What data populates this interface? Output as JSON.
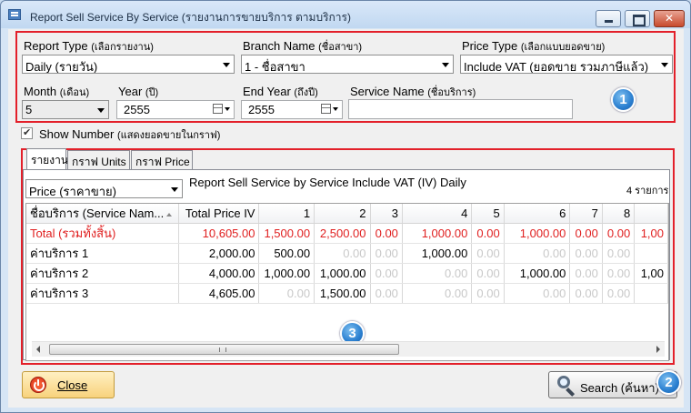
{
  "window": {
    "title": "Report Sell Service By Service (รายงานการขายบริการ ตามบริการ)"
  },
  "filters": {
    "report_type": {
      "label": "Report Type",
      "label_th": "(เลือกรายงาน)",
      "value": "Daily (รายวัน)"
    },
    "branch_name": {
      "label": "Branch Name",
      "label_th": "(ชื่อสาขา)",
      "value": "1 - ชื่อสาขา"
    },
    "price_type": {
      "label": "Price Type",
      "label_th": "(เลือกแบบยอดขาย)",
      "value": "Include VAT (ยอดขาย รวมภาษีแล้ว)"
    },
    "month": {
      "label": "Month",
      "label_th": "(เดือน)",
      "value": "5"
    },
    "year": {
      "label": "Year",
      "label_th": "(ปี)",
      "value": "2555"
    },
    "end_year": {
      "label": "End Year",
      "label_th": "(ถึงปี)",
      "value": "2555"
    },
    "service_name": {
      "label": "Service Name",
      "label_th": "(ชื่อบริการ)",
      "value": ""
    },
    "show_number": {
      "label": "Show Number",
      "label_th": "(แสดงยอดขายในกราฟ)",
      "checked": true
    }
  },
  "tabs": [
    {
      "label": "รายงาน",
      "active": true
    },
    {
      "label": "กราฟ Units",
      "active": false
    },
    {
      "label": "กราฟ Price",
      "active": false
    }
  ],
  "report": {
    "view_select": "Price (ราคาขาย)",
    "heading": "Report Sell Service by Service Include VAT (IV) Daily",
    "count": "4 รายการ",
    "columns": [
      "ชื่อบริการ (Service Nam...",
      "Total Price IV",
      "1",
      "2",
      "3",
      "4",
      "5",
      "6",
      "7",
      "8",
      ""
    ],
    "rows": [
      {
        "type": "total",
        "cells": [
          "Total (รวมทั้งสิ้น)",
          "10,605.00",
          "1,500.00",
          "2,500.00",
          "0.00",
          "1,000.00",
          "0.00",
          "1,000.00",
          "0.00",
          "0.00",
          "1,00"
        ]
      },
      {
        "type": "row",
        "cells": [
          "ค่าบริการ 1",
          "2,000.00",
          "500.00",
          "0.00",
          "0.00",
          "1,000.00",
          "0.00",
          "0.00",
          "0.00",
          "0.00",
          ""
        ]
      },
      {
        "type": "row",
        "cells": [
          "ค่าบริการ 2",
          "4,000.00",
          "1,000.00",
          "1,000.00",
          "0.00",
          "0.00",
          "0.00",
          "1,000.00",
          "0.00",
          "0.00",
          "1,00"
        ]
      },
      {
        "type": "row",
        "cells": [
          "ค่าบริการ 3",
          "4,605.00",
          "0.00",
          "1,500.00",
          "0.00",
          "0.00",
          "0.00",
          "0.00",
          "0.00",
          "0.00",
          ""
        ]
      }
    ]
  },
  "buttons": {
    "close": "Close",
    "search": "Search (ค้นหา)"
  },
  "badges": [
    "1",
    "2",
    "3"
  ],
  "colors": {
    "highlight_border": "#e3202a",
    "total_row": "#e02020",
    "badge": "#2a7fd0"
  }
}
